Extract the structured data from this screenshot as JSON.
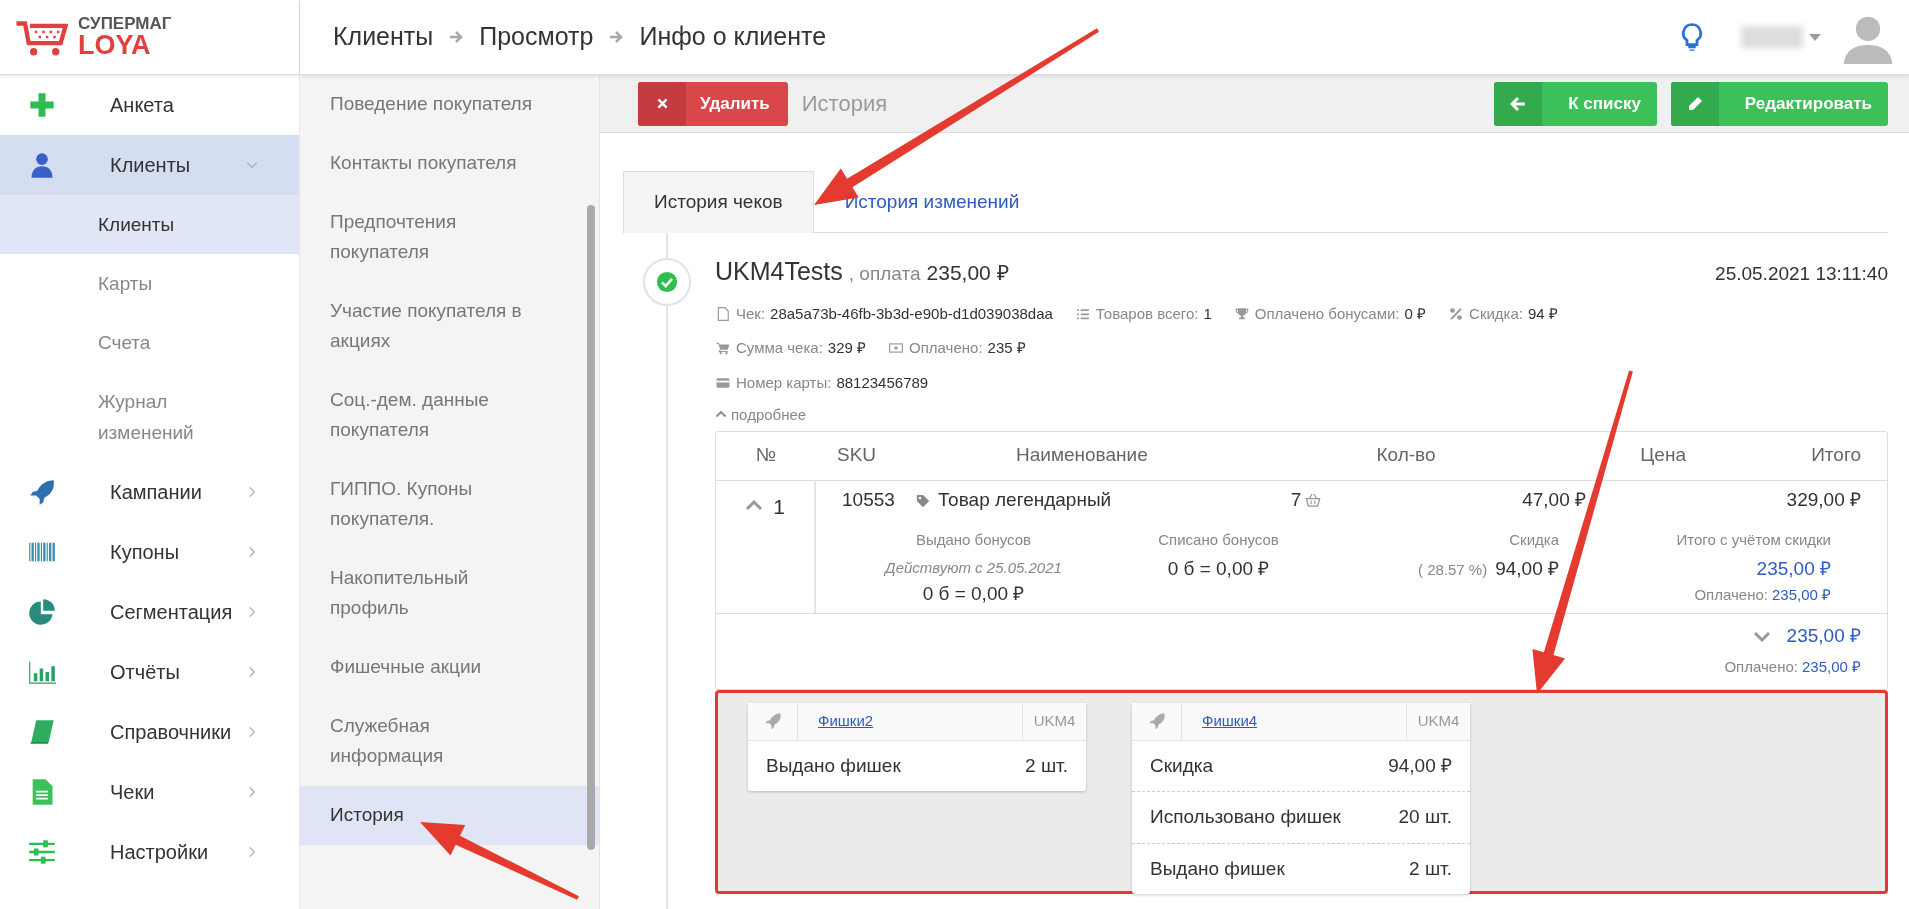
{
  "brand": {
    "line1": "СУПЕРМАГ",
    "line2": "LOYA"
  },
  "breadcrumbs": [
    "Клиенты",
    "Просмотр",
    "Инфо о клиенте"
  ],
  "sidebar": {
    "items": [
      {
        "label": "Анкета",
        "selected": false
      },
      {
        "label": "Клиенты",
        "selected": true,
        "expanded": true,
        "children": [
          {
            "label": "Клиенты",
            "selected": true
          },
          {
            "label": "Карты",
            "selected": false
          },
          {
            "label": "Счета",
            "selected": false
          },
          {
            "label": "Журнал изменений",
            "selected": false
          }
        ]
      },
      {
        "label": "Кампании",
        "selected": false,
        "expanded": false
      },
      {
        "label": "Купоны",
        "selected": false,
        "expanded": false
      },
      {
        "label": "Сегментация",
        "selected": false,
        "expanded": false
      },
      {
        "label": "Отчёты",
        "selected": false,
        "expanded": false
      },
      {
        "label": "Справочники",
        "selected": false,
        "expanded": false
      },
      {
        "label": "Чеки",
        "selected": false,
        "expanded": false
      },
      {
        "label": "Настройки",
        "selected": false,
        "expanded": false
      }
    ]
  },
  "subnav": [
    {
      "label": "Поведение покупателя",
      "selected": false
    },
    {
      "label": "Контакты покупателя",
      "selected": false
    },
    {
      "label": "Предпочтения покупателя",
      "selected": false
    },
    {
      "label": "Участие покупателя в акциях",
      "selected": false
    },
    {
      "label": "Соц.-дем. данные покупателя",
      "selected": false
    },
    {
      "label": "ГИППО. Купоны покупателя.",
      "selected": false
    },
    {
      "label": "Накопительный профиль",
      "selected": false
    },
    {
      "label": "Фишечные акции",
      "selected": false
    },
    {
      "label": "Служебная информация",
      "selected": false
    },
    {
      "label": "История",
      "selected": true
    }
  ],
  "toolbar": {
    "page_title": "История",
    "delete_button": "Удалить",
    "back_button": "К списку",
    "edit_button": "Редактировать"
  },
  "tabs": [
    {
      "label": "История чеков",
      "selected": true
    },
    {
      "label": "История изменений",
      "selected": false
    }
  ],
  "receipt": {
    "store": "UKM4Tests",
    "payment_label": ", оплата",
    "payment": "235,00 ₽",
    "datetime": "25.05.2021 13:11:40",
    "fact_lines": [
      [
        {
          "label": "Чек:",
          "value": "28a5a73b-46fb-3b3d-e90b-d1d039038daa"
        },
        {
          "label": "Товаров всего:",
          "value": "1"
        },
        {
          "label": "Оплачено бонусами:",
          "value": "0 ₽"
        },
        {
          "label": "Скидка:",
          "value": "94 ₽"
        }
      ],
      [
        {
          "label": "Сумма чека:",
          "value": "329 ₽"
        },
        {
          "label": "Оплачено:",
          "value": "235 ₽"
        }
      ],
      [
        {
          "label": "Номер карты:",
          "value": "88123456789"
        }
      ]
    ],
    "details_toggle": {
      "label": "подробнее",
      "expanded": true
    }
  },
  "table": {
    "columns": [
      "№",
      "SKU",
      "Наименование",
      "Кол-во",
      "Цена",
      "Итого"
    ],
    "rows": [
      {
        "number": "1",
        "expanded": true,
        "sku": "10553",
        "name": "Товар легендарный",
        "qty": "7",
        "price": "47,00 ₽",
        "total": "329,00 ₽",
        "bonus_issued_label": "Выдано бонусов",
        "bonus_valid": "Действуют с 25.05.2021",
        "bonus_issued": "0 б = 0,00 ₽",
        "bonus_spent_label": "Списано бонусов",
        "bonus_spent": "0 б = 0,00 ₽",
        "discount_label": "Скидка",
        "discount_percent": "( 28.57 %)",
        "discount": "94,00 ₽",
        "discounted_total_label": "Итого с учётом скидки",
        "discounted_total": "235,00 ₽",
        "paid_label": "Оплачено:",
        "paid": "235,00 ₽"
      }
    ],
    "footer": {
      "expanded": false,
      "total": "235,00 ₽",
      "paid_label": "Оплачено:",
      "paid": "235,00 ₽"
    }
  },
  "promos": [
    {
      "name": "Фишки2",
      "source": "UKM4",
      "lines": [
        {
          "label": "Выдано фишек",
          "value": "2 шт."
        }
      ]
    },
    {
      "name": "Фишки4",
      "source": "UKM4",
      "lines": [
        {
          "label": "Скидка",
          "value": "94,00 ₽"
        },
        {
          "label": "Использовано фишек",
          "value": "20 шт."
        },
        {
          "label": "Выдано фишек",
          "value": "2 шт."
        }
      ]
    }
  ],
  "annotations": [
    {
      "kind": "arrow"
    },
    {
      "kind": "arrow"
    },
    {
      "kind": "arrow"
    },
    {
      "kind": "frame"
    }
  ]
}
